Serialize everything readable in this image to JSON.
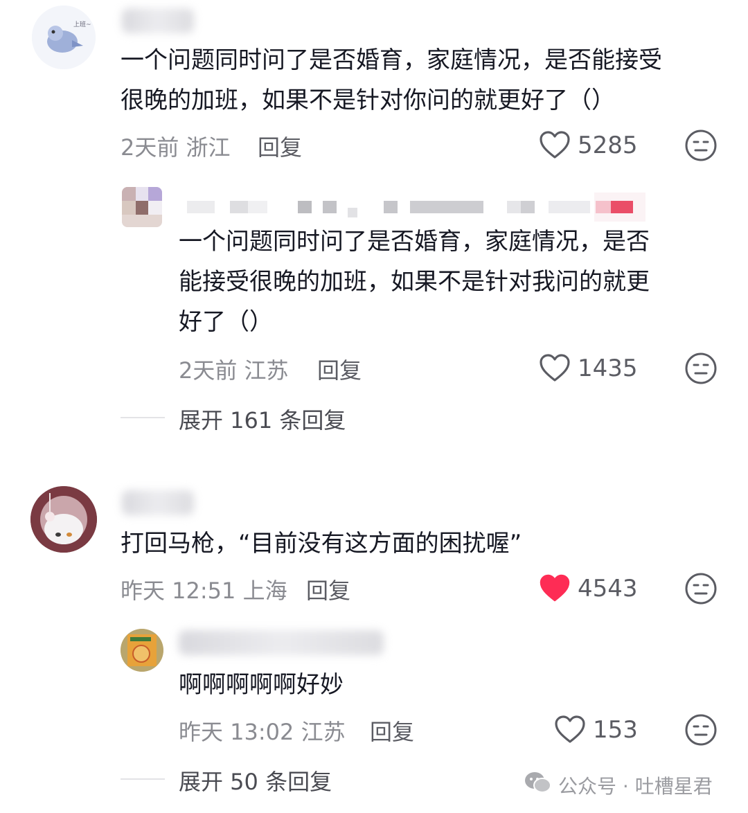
{
  "comments": [
    {
      "text": "一个问题同时问了是否婚育，家庭情况，是否能接受\n很晚的加班，如果不是针对你问的就更好了（）",
      "meta": "2天前 浙江",
      "reply_label": "回复",
      "likes": "5285",
      "liked": false,
      "replies": [
        {
          "text": "一个问题同时问了是否婚育，家庭情况，是否\n能接受很晚的加班，如果不是针对我问的就更\n好了（）",
          "meta": "2天前 江苏",
          "reply_label": "回复",
          "likes": "1435",
          "liked": false
        }
      ],
      "expand_label": "展开 161 条回复"
    },
    {
      "text": "打回马枪，“目前没有这方面的困扰喔”",
      "meta": "昨天 12:51 上海",
      "reply_label": "回复",
      "likes": "4543",
      "liked": true,
      "replies": [
        {
          "text": "啊啊啊啊啊好妙",
          "meta": "昨天 13:02 江苏",
          "reply_label": "回复",
          "likes": "153",
          "liked": false
        }
      ],
      "expand_label": "展开 50 条回复"
    }
  ],
  "watermark": "公众号 · 吐槽星君",
  "colors": {
    "like_red": "#fe2c55",
    "text": "#161823",
    "meta": "#8a8b91"
  },
  "icons": {
    "like": "heart-icon",
    "dislike": "meh-face-icon",
    "watermark": "wechat-icon"
  }
}
